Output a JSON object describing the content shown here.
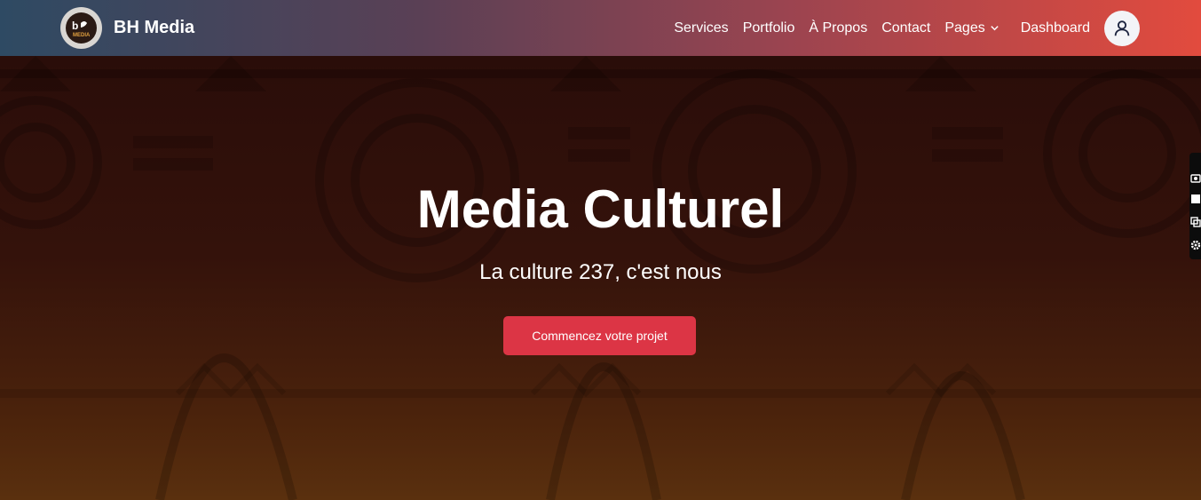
{
  "brand": {
    "name": "BH Media",
    "logo_text": "bh MEDIA"
  },
  "nav": {
    "items": [
      {
        "label": "Services"
      },
      {
        "label": "Portfolio"
      },
      {
        "label": "À Propos"
      },
      {
        "label": "Contact"
      },
      {
        "label": "Pages"
      },
      {
        "label": "Dashboard"
      }
    ],
    "user_icon": "user-icon"
  },
  "hero": {
    "title": "Media Culturel",
    "subtitle": "La culture 237, c'est nous",
    "cta_label": "Commencez votre projet"
  },
  "colors": {
    "nav_gradient_start": "#2e4a63",
    "nav_gradient_end": "#e24b3e",
    "cta": "#dc3545"
  },
  "side_widget": {
    "icons": [
      "camera-icon",
      "square-icon",
      "copy-icon",
      "gear-icon"
    ]
  }
}
